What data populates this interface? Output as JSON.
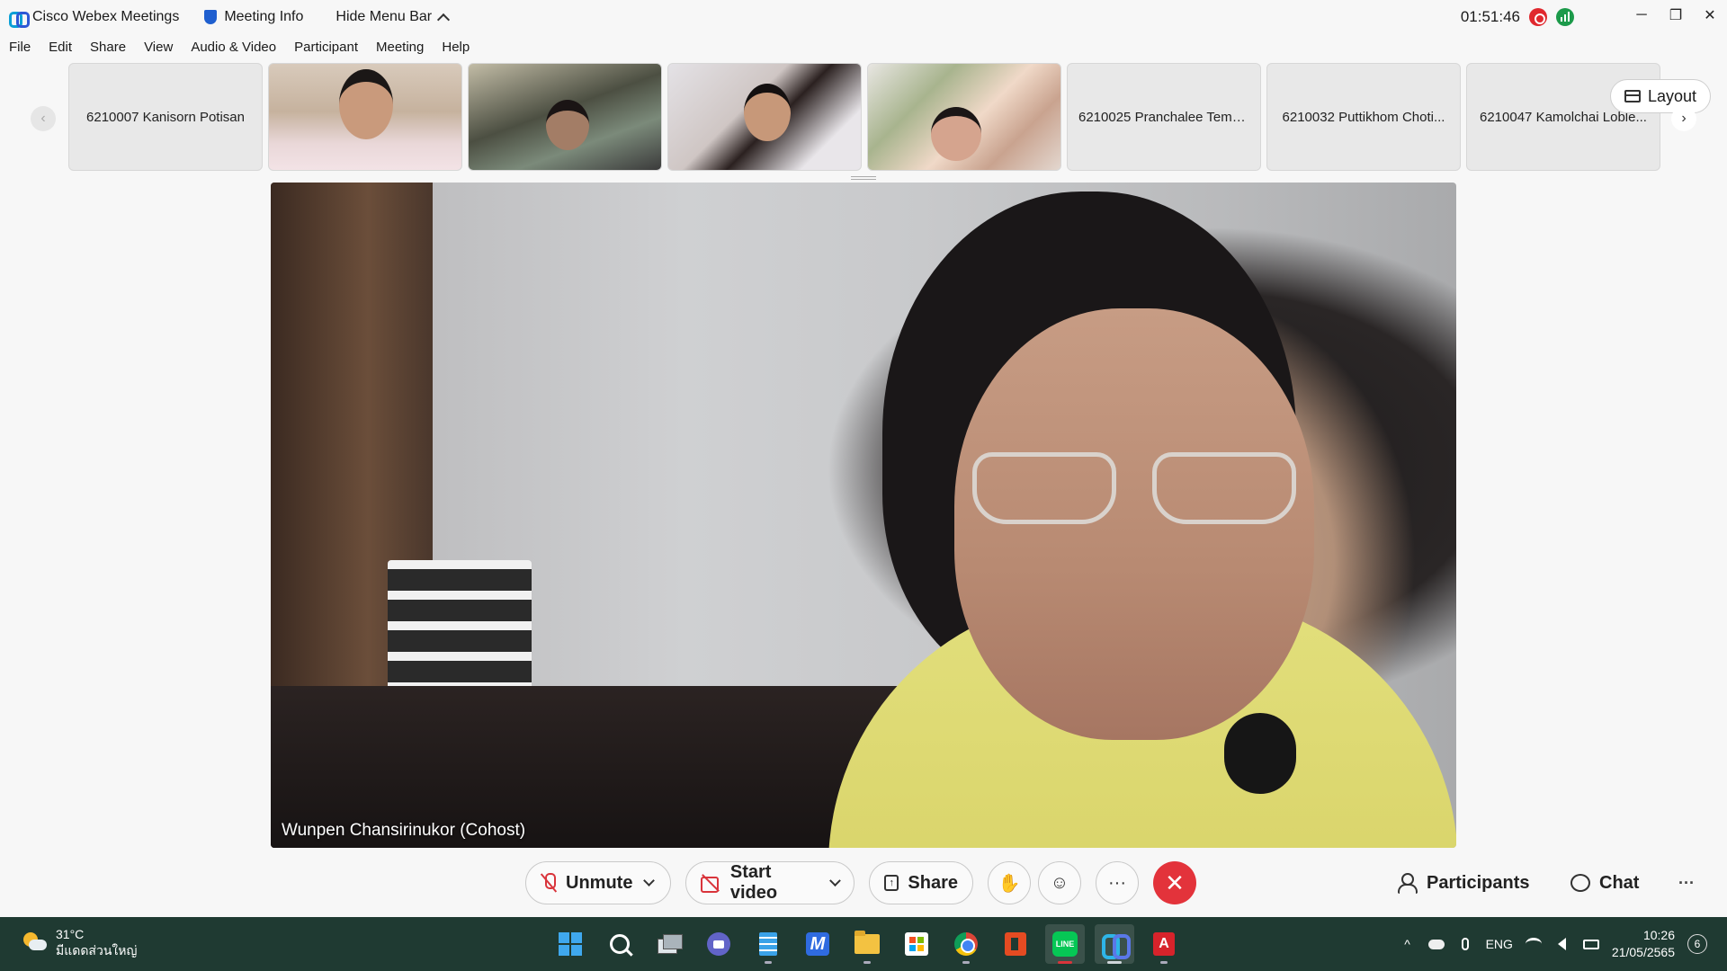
{
  "titlebar": {
    "app_title": "Cisco Webex Meetings",
    "meeting_info": "Meeting Info",
    "hide_menu": "Hide Menu Bar",
    "clock": "01:51:46",
    "minimize": "─",
    "restore": "❐",
    "close": "✕"
  },
  "menu": [
    "File",
    "Edit",
    "Share",
    "View",
    "Audio & Video",
    "Participant",
    "Meeting",
    "Help"
  ],
  "filmstrip": {
    "prev": "‹",
    "next": "›",
    "tiles": [
      {
        "name": "6210007 Kanisorn Potisan",
        "video": false
      },
      {
        "name": "",
        "video": true
      },
      {
        "name": "",
        "video": true
      },
      {
        "name": "",
        "video": true
      },
      {
        "name": "",
        "video": true
      },
      {
        "name": "6210025 Pranchalee Tems...",
        "video": false
      },
      {
        "name": "6210032 Puttikhom Choti...",
        "video": false
      },
      {
        "name": "6210047 Kamolchai Loble...",
        "video": false
      }
    ],
    "layout_label": "Layout"
  },
  "main_video": {
    "speaker": "Wunpen Chansirinukor (Cohost)"
  },
  "controls": {
    "unmute": "Unmute",
    "start_video": "Start video",
    "share": "Share",
    "raise_hand": "✋",
    "reactions": "☺",
    "more": "···",
    "end": "✕",
    "participants": "Participants",
    "chat": "Chat",
    "overflow": "···"
  },
  "taskbar": {
    "weather_temp": "31°C",
    "weather_desc": "มีแดดส่วนใหญ่",
    "apps": [
      "windows-start",
      "search",
      "task-view",
      "teams-chat",
      "notepad",
      "editor",
      "file-explorer",
      "microsoft-store",
      "chrome",
      "office",
      "line",
      "webex",
      "acrobat"
    ],
    "tray": {
      "chevron": "^",
      "lang": "ENG",
      "time": "10:26",
      "date": "21/05/2565",
      "notifications": "6"
    }
  },
  "colors": {
    "accent_red": "#e3333b",
    "taskbar_bg": "#1f3a32",
    "webex_blue": "#0a7cd6"
  }
}
